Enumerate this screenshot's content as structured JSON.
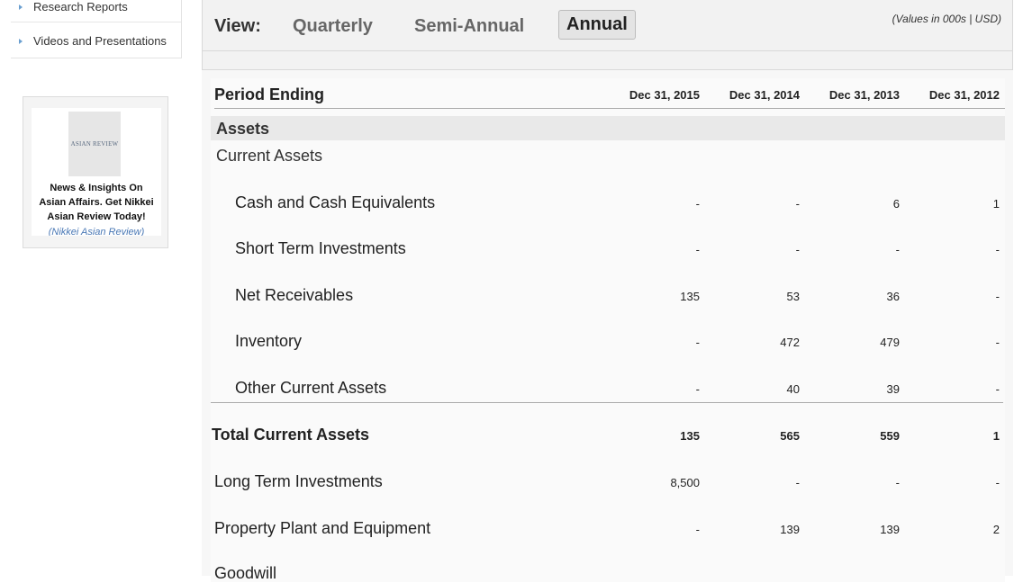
{
  "sidebar": {
    "links": [
      "Research Reports",
      "Videos and Presentations"
    ]
  },
  "ad": {
    "logo_text": "ASIAN REVIEW",
    "text_lines": [
      "News & Insights On",
      "Asian Affairs. Get Nikkei",
      "Asian Review Today!"
    ],
    "link_text": "(Nikkei Asian Review)"
  },
  "view": {
    "label": "View:",
    "tabs": [
      "Quarterly",
      "Semi-Annual",
      "Annual"
    ],
    "active_tab": "Annual",
    "units_note": "(Values in 000s | USD)"
  },
  "table": {
    "period_label": "Period Ending",
    "columns": [
      "Dec 31, 2015",
      "Dec 31, 2014",
      "Dec 31, 2013",
      "Dec 31, 2012"
    ],
    "section": "Assets",
    "subsection": "Current Assets",
    "rows": [
      {
        "label": "Cash and Cash Equivalents",
        "values": [
          "-",
          "-",
          "6",
          "1"
        ]
      },
      {
        "label": "Short Term Investments",
        "values": [
          "-",
          "-",
          "-",
          "-"
        ]
      },
      {
        "label": "Net Receivables",
        "values": [
          "135",
          "53",
          "36",
          "-"
        ]
      },
      {
        "label": "Inventory",
        "values": [
          "-",
          "472",
          "479",
          "-"
        ]
      },
      {
        "label": "Other Current Assets",
        "values": [
          "-",
          "40",
          "39",
          "-"
        ]
      },
      {
        "label": "Total Current Assets",
        "values": [
          "135",
          "565",
          "559",
          "1"
        ]
      },
      {
        "label": "Long Term Investments",
        "values": [
          "8,500",
          "-",
          "-",
          "-"
        ]
      },
      {
        "label": "Property Plant and Equipment",
        "values": [
          "-",
          "139",
          "139",
          "2"
        ]
      },
      {
        "label": "Goodwill",
        "values": [
          "",
          "",
          "",
          ""
        ]
      }
    ]
  },
  "colors": {
    "accent_link": "#4a78b5",
    "band": "#e9e9e9"
  }
}
